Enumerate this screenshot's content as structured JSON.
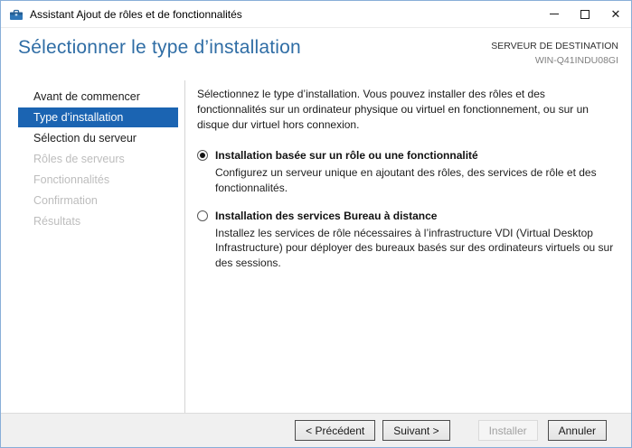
{
  "titlebar": {
    "title": "Assistant Ajout de rôles et de fonctionnalités",
    "close_glyph": "✕"
  },
  "header": {
    "page_title": "Sélectionner le type d’installation",
    "destination_label": "SERVEUR DE DESTINATION",
    "destination_server": "WIN-Q41INDU08GI"
  },
  "sidebar": {
    "items": [
      {
        "label": "Avant de commencer",
        "state": "enabled"
      },
      {
        "label": "Type d’installation",
        "state": "selected"
      },
      {
        "label": "Sélection du serveur",
        "state": "enabled"
      },
      {
        "label": "Rôles de serveurs",
        "state": "disabled"
      },
      {
        "label": "Fonctionnalités",
        "state": "disabled"
      },
      {
        "label": "Confirmation",
        "state": "disabled"
      },
      {
        "label": "Résultats",
        "state": "disabled"
      }
    ]
  },
  "main": {
    "intro": "Sélectionnez le type d’installation. Vous pouvez installer des rôles et des fonctionnalités sur un ordinateur physique ou virtuel en fonctionnement, ou sur un disque dur virtuel hors connexion.",
    "options": [
      {
        "label": "Installation basée sur un rôle ou une fonctionnalité",
        "description": "Configurez un serveur unique en ajoutant des rôles, des services de rôle et des fonctionnalités.",
        "selected": true
      },
      {
        "label": "Installation des services Bureau à distance",
        "description": "Installez les services de rôle nécessaires à l’infrastructure VDI (Virtual Desktop Infrastructure) pour déployer des bureaux basés sur des ordinateurs virtuels ou sur des sessions.",
        "selected": false
      }
    ]
  },
  "footer": {
    "buttons": [
      {
        "label": "< Précédent",
        "enabled": true
      },
      {
        "label": "Suivant >",
        "enabled": true
      },
      {
        "label": "Installer",
        "enabled": false
      },
      {
        "label": "Annuler",
        "enabled": true
      }
    ]
  },
  "colors": {
    "nav_selected_bg": "#1b64b2",
    "page_title_blue": "#2f6da5",
    "window_border": "#88aed8",
    "footer_bg": "#f0f0f0"
  }
}
